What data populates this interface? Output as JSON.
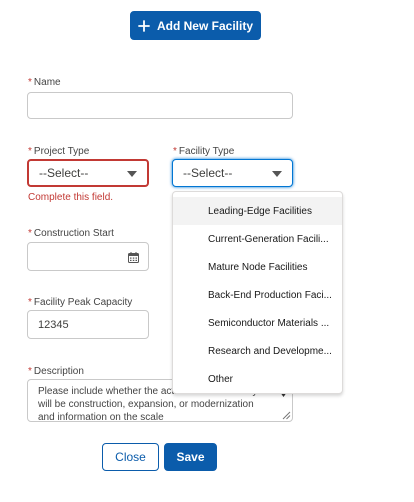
{
  "add_button": {
    "label": "Add New Facility",
    "icon": "plus-icon"
  },
  "required_marker": "*",
  "form": {
    "name": {
      "label": "Name",
      "value": ""
    },
    "project_type": {
      "label": "Project Type",
      "value": "--Select--",
      "error": "Complete this field."
    },
    "facility_type": {
      "label": "Facility Type",
      "value": "--Select--",
      "options": [
        "Leading-Edge Facilities",
        "Current-Generation Facili...",
        "Mature Node Facilities",
        "Back-End Production Faci...",
        "Semiconductor Materials ...",
        "Research and Developme...",
        "Other"
      ],
      "highlighted_option": "Leading-Edge Facilities"
    },
    "construction_start": {
      "label": "Construction Start",
      "value": "",
      "icon": "calendar-icon"
    },
    "facility_peak_capacity": {
      "label": "Facility Peak Capacity",
      "value": "12345"
    },
    "description": {
      "label": "Description",
      "value": "Please include whether the activities at the facility will be construction, expansion, or modernization and information on the scale"
    }
  },
  "footer": {
    "close_label": "Close",
    "save_label": "Save"
  },
  "colors": {
    "brand": "#0b5cab",
    "error": "#c23934",
    "focus": "#0176d3"
  }
}
